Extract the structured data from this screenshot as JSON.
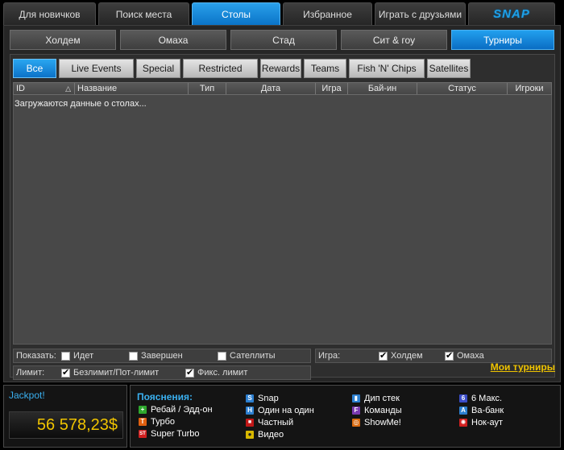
{
  "top_tabs": [
    "Для новичков",
    "Поиск места",
    "Столы",
    "Избранное",
    "Играть с друзьями"
  ],
  "logo_text": "SNAP",
  "sub_tabs": [
    "Холдем",
    "Омаха",
    "Стад",
    "Сит & гоу",
    "Турниры"
  ],
  "filter_buttons": [
    "Все",
    "Live Events",
    "Special",
    "Restricted",
    "Rewards",
    "Teams",
    "Fish 'N' Chips",
    "Satellites"
  ],
  "columns": [
    "ID",
    "Название",
    "Тип",
    "Дата",
    "Игра",
    "Бай-ин",
    "Статус",
    "Игроки"
  ],
  "loading_text": "Загружаются данные о столах...",
  "show": {
    "label": "Показать:",
    "options": [
      {
        "label": "Идет",
        "checked": false
      },
      {
        "label": "Завершен",
        "checked": false
      },
      {
        "label": "Сателлиты",
        "checked": false
      }
    ]
  },
  "game": {
    "label": "Игра:",
    "options": [
      {
        "label": "Холдем",
        "checked": true
      },
      {
        "label": "Омаха",
        "checked": true
      }
    ]
  },
  "limit": {
    "label": "Лимит:",
    "options": [
      {
        "label": "Безлимит/Пот-лимит",
        "checked": true
      },
      {
        "label": "Фикс. лимит",
        "checked": true
      }
    ]
  },
  "my_tournaments": "Мои турниры",
  "jackpot": {
    "label": "Jackpot!",
    "value": "56 578,23$"
  },
  "legend": {
    "title": "Пояснения:",
    "items": [
      {
        "icon": "plus-icon",
        "label": "Ребай / Эдд-он",
        "color": "#2ea82e",
        "glyph": "+"
      },
      {
        "icon": "turbo-icon",
        "label": "Турбо",
        "color": "#e06010",
        "glyph": "T"
      },
      {
        "icon": "super-turbo-icon",
        "label": "Super Turbo",
        "color": "#d02020",
        "glyph": "ST"
      },
      {
        "icon": "snap-icon",
        "label": "Snap",
        "color": "#2c7fd0",
        "glyph": "S"
      },
      {
        "icon": "heads-up-icon",
        "label": "Один на один",
        "color": "#2c7fd0",
        "glyph": "H"
      },
      {
        "icon": "lock-icon",
        "label": "Частный",
        "color": "#c01818",
        "glyph": "■"
      },
      {
        "icon": "video-icon",
        "label": "Видео",
        "color": "#d8b800",
        "glyph": "●"
      },
      {
        "icon": "deep-stack-icon",
        "label": "Дип стек",
        "color": "#2c7fd0",
        "glyph": "▮"
      },
      {
        "icon": "teams-icon",
        "label": "Команды",
        "color": "#7a3ab0",
        "glyph": "F"
      },
      {
        "icon": "showme-icon",
        "label": "ShowMe!",
        "color": "#d86a10",
        "glyph": "◎"
      },
      {
        "icon": "six-max-icon",
        "label": "6 Макс.",
        "color": "#3a4cc8",
        "glyph": "6"
      },
      {
        "icon": "all-in-icon",
        "label": "Ва-банк",
        "color": "#2c7fd0",
        "glyph": "A"
      },
      {
        "icon": "knockout-icon",
        "label": "Нок-аут",
        "color": "#d02020",
        "glyph": "✺"
      }
    ]
  }
}
